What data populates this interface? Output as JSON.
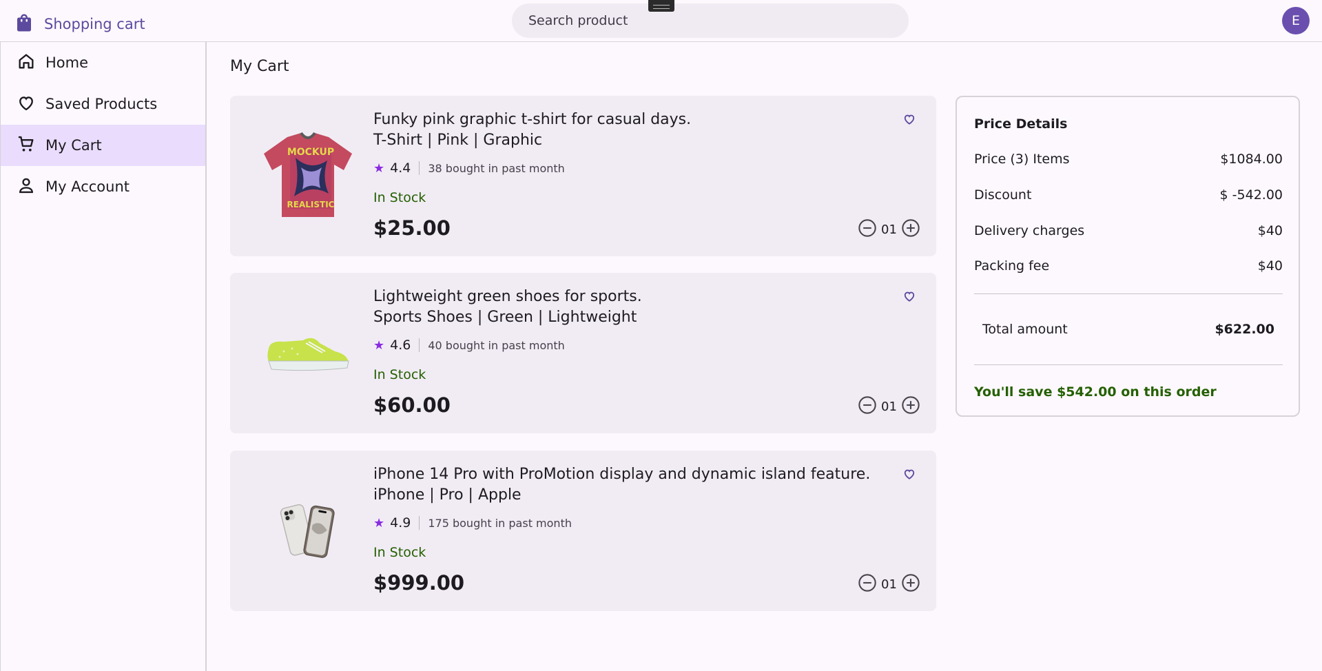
{
  "header": {
    "brand": "Shopping cart",
    "search_placeholder": "Search product",
    "avatar_initial": "E"
  },
  "sidebar": {
    "items": [
      {
        "label": "Home",
        "icon": "home-icon"
      },
      {
        "label": "Saved Products",
        "icon": "heart-icon"
      },
      {
        "label": "My Cart",
        "icon": "cart-icon",
        "active": true
      },
      {
        "label": "My Account",
        "icon": "person-icon"
      }
    ]
  },
  "main": {
    "title": "My Cart",
    "items": [
      {
        "title_line1": "Funky pink graphic t-shirt for casual days.",
        "title_line2": "T-Shirt | Pink | Graphic",
        "rating": "4.4",
        "bought": "38 bought in past month",
        "stock": "In Stock",
        "price": "$25.00",
        "qty": "01",
        "image": "pink-tshirt-image",
        "tshirt_text_top": "MOCKUP",
        "tshirt_text_bottom": "REALISTIC"
      },
      {
        "title_line1": "Lightweight green shoes for sports.",
        "title_line2": "Sports Shoes | Green | Lightweight",
        "rating": "4.6",
        "bought": "40 bought in past month",
        "stock": "In Stock",
        "price": "$60.00",
        "qty": "01",
        "image": "green-shoe-image"
      },
      {
        "title_line1": "iPhone 14 Pro with ProMotion display and dynamic island feature.",
        "title_line2": "iPhone | Pro | Apple",
        "rating": "4.9",
        "bought": "175 bought in past month",
        "stock": "In Stock",
        "price": "$999.00",
        "qty": "01",
        "image": "iphone-image"
      }
    ]
  },
  "price_details": {
    "title": "Price Details",
    "rows": [
      {
        "label": "Price (3) Items",
        "value": "$1084.00"
      },
      {
        "label": "Discount",
        "value": "$ -542.00"
      },
      {
        "label": "Delivery charges",
        "value": "$40"
      },
      {
        "label": "Packing fee",
        "value": "$40"
      }
    ],
    "total_label": "Total amount",
    "total_value": "$622.00",
    "savings": "You'll save $542.00 on this order"
  },
  "colors": {
    "accent": "#5b4a9e",
    "active_nav": "#eadcfd",
    "card_bg": "#f1ecf4",
    "in_stock": "#246000",
    "star": "#8a2be2"
  }
}
